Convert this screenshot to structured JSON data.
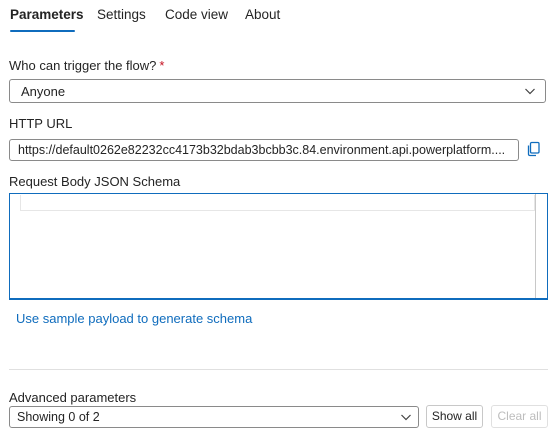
{
  "tabs": [
    {
      "label": "Parameters",
      "active": true
    },
    {
      "label": "Settings",
      "active": false
    },
    {
      "label": "Code view",
      "active": false
    },
    {
      "label": "About",
      "active": false
    }
  ],
  "trigger": {
    "label": "Who can trigger the flow?",
    "required_mark": "*",
    "value": "Anyone"
  },
  "http_url": {
    "label": "HTTP URL",
    "value": "https://default0262e82232cc4173b32bdab3bcbb3c.84.environment.api.powerplatform...."
  },
  "schema": {
    "label": "Request Body JSON Schema",
    "value": ""
  },
  "sample_link": "Use sample payload to generate schema",
  "advanced": {
    "label": "Advanced parameters",
    "value": "Showing 0 of 2",
    "show_all": "Show all",
    "clear_all": "Clear all"
  },
  "colors": {
    "accent": "#0f6cbd",
    "required": "#c50f1f",
    "disabled_text": "#bdbdbd"
  },
  "icons": {
    "dropdown": "chevron-down-icon",
    "copy": "copy-icon"
  }
}
